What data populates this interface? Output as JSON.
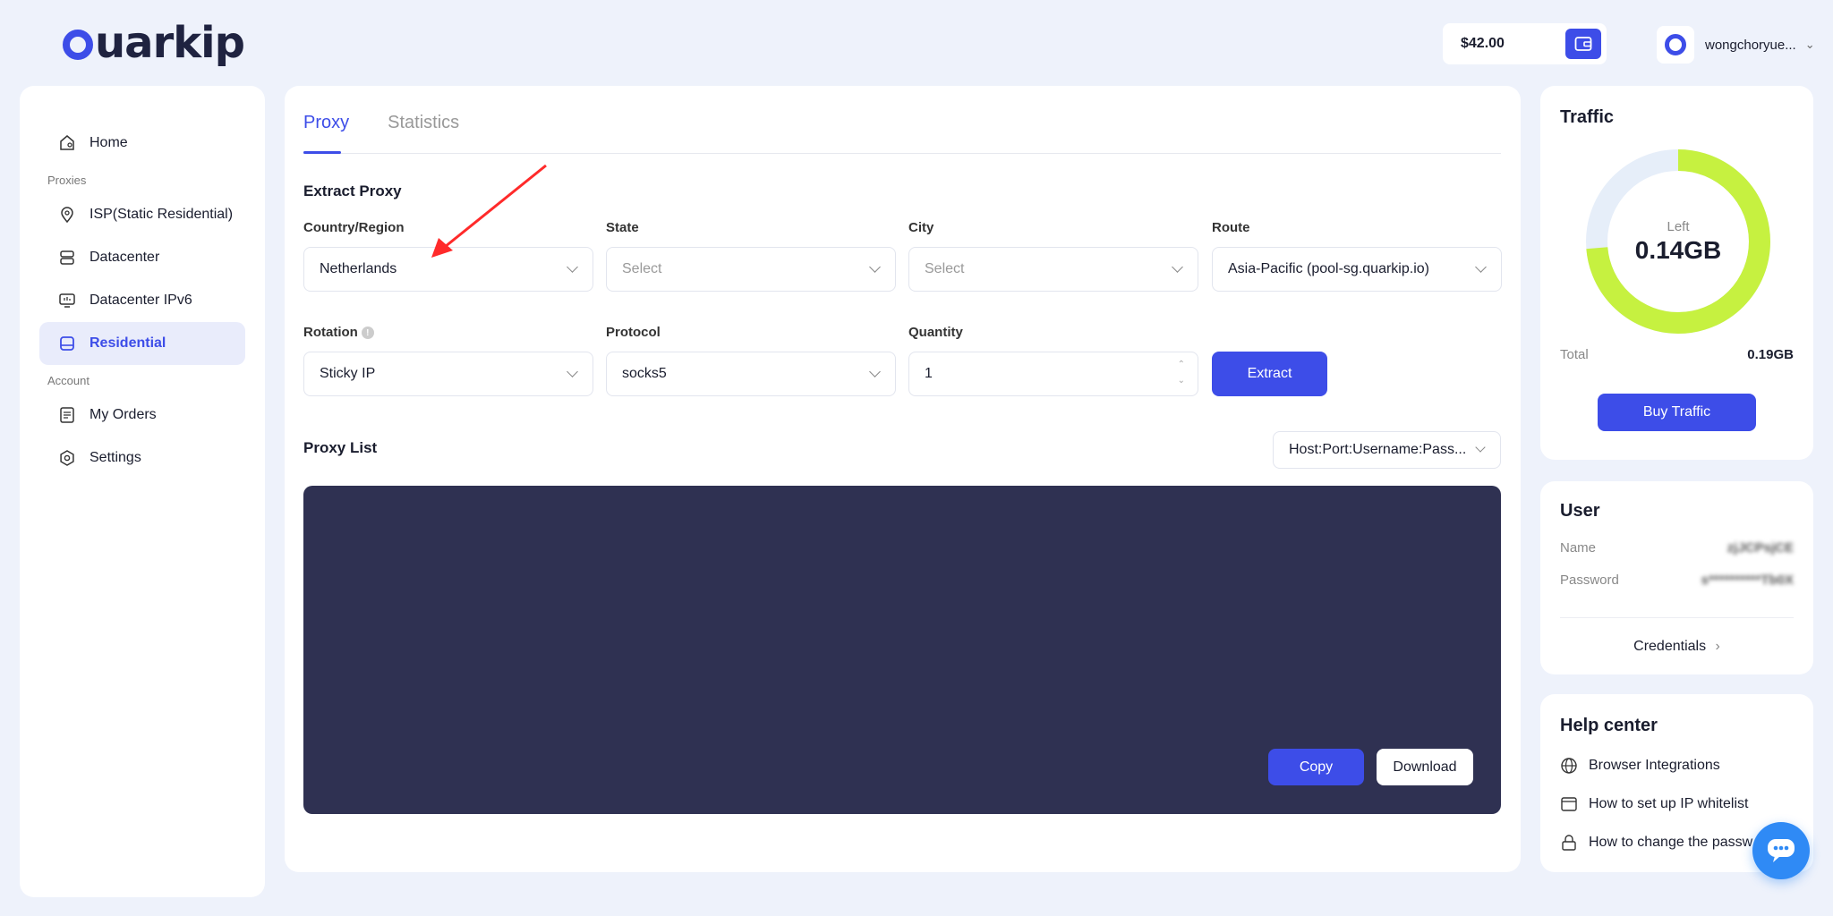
{
  "brand": {
    "logo_text": "uarkip"
  },
  "header": {
    "balance": "$42.00",
    "username": "wongchoryue..."
  },
  "sidebar": {
    "home": "Home",
    "section_proxies": "Proxies",
    "isp": "ISP(Static Residential)",
    "datacenter": "Datacenter",
    "datacenter_ipv6": "Datacenter IPv6",
    "residential": "Residential",
    "section_account": "Account",
    "orders": "My Orders",
    "settings": "Settings"
  },
  "main": {
    "tabs": [
      {
        "label": "Proxy"
      },
      {
        "label": "Statistics"
      }
    ],
    "extract_title": "Extract Proxy",
    "fields": {
      "country_label": "Country/Region",
      "country_value": "Netherlands",
      "state_label": "State",
      "state_placeholder": "Select",
      "city_label": "City",
      "city_placeholder": "Select",
      "route_label": "Route",
      "route_value": "Asia-Pacific (pool-sg.quarkip.io)",
      "rotation_label": "Rotation",
      "rotation_value": "Sticky IP",
      "protocol_label": "Protocol",
      "protocol_value": "socks5",
      "quantity_label": "Quantity",
      "quantity_value": "1"
    },
    "extract_button": "Extract",
    "proxy_list_title": "Proxy List",
    "format_value": "Host:Port:Username:Pass...",
    "copy_button": "Copy",
    "download_button": "Download"
  },
  "traffic": {
    "title": "Traffic",
    "left_label": "Left",
    "left_value": "0.14GB",
    "left_fraction": 0.737,
    "total_label": "Total",
    "total_value": "0.19GB",
    "buy_button": "Buy Traffic",
    "ring_color": "#c6f140",
    "ring_track_color": "#e6eef9"
  },
  "user": {
    "title": "User",
    "name_label": "Name",
    "name_value": "zjJCPsjCE",
    "password_label": "Password",
    "password_value": "s**********Tb0X",
    "credentials_link": "Credentials"
  },
  "help": {
    "title": "Help center",
    "items": [
      {
        "label": "Browser Integrations"
      },
      {
        "label": "How to set up IP whitelist"
      },
      {
        "label": "How to change the passw"
      }
    ]
  },
  "colors": {
    "accent": "#3d4de8",
    "dark_panel": "#2f3152",
    "annotation": "#ff2a2a"
  }
}
